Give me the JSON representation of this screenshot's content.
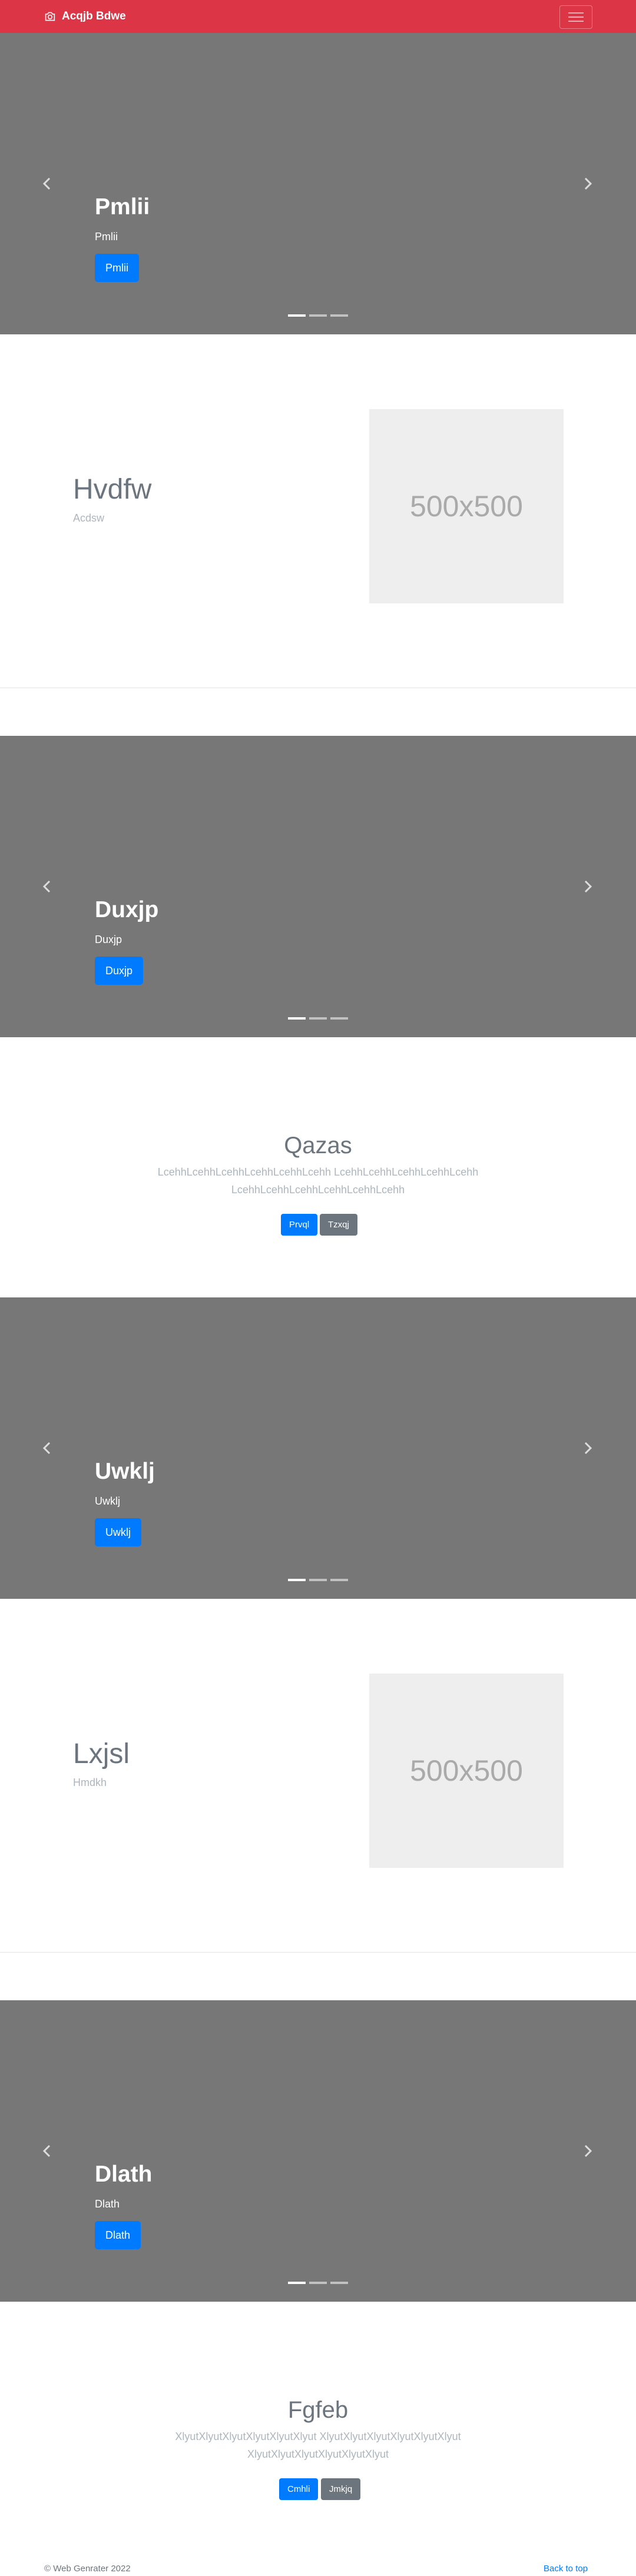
{
  "navbar": {
    "brand": "Acqjb Bdwe",
    "icon": "camera-icon",
    "toggler_icon": "hamburger-icon"
  },
  "carousels": [
    {
      "title": "Pmlii",
      "subtitle": "Pmlii",
      "button": "Pmlii"
    },
    {
      "title": "Duxjp",
      "subtitle": "Duxjp",
      "button": "Duxjp"
    },
    {
      "title": "Uwklj",
      "subtitle": "Uwklj",
      "button": "Uwklj"
    },
    {
      "title": "Dlath",
      "subtitle": "Dlath",
      "button": "Dlath"
    }
  ],
  "features": [
    {
      "title": "Hvdfw",
      "subtitle": "Acdsw",
      "image_label": "500x500"
    },
    {
      "title": "Lxjsl",
      "subtitle": "Hmdkh",
      "image_label": "500x500"
    }
  ],
  "jumbotrons": [
    {
      "title": "Qazas",
      "lead_line1": "LcehhLcehhLcehhLcehhLcehhLcehh LcehhLcehhLcehhLcehhLcehh",
      "lead_line2": "LcehhLcehhLcehhLcehhLcehhLcehh",
      "primary": "Prvql",
      "secondary": "Tzxqj"
    },
    {
      "title": "Fgfeb",
      "lead_line1": "XlyutXlyutXlyutXlyutXlyutXlyut XlyutXlyutXlyutXlyutXlyutXlyut",
      "lead_line2": "XlyutXlyutXlyutXlyutXlyutXlyut",
      "primary": "Cmhli",
      "secondary": "Jmkjq"
    }
  ],
  "footer": {
    "copyright": "© Web Genrater 2022",
    "back_to_top": "Back to top"
  },
  "colors": {
    "navbar": "#dc3545",
    "carousel_bg": "#777777",
    "primary": "#007bff",
    "secondary": "#6c757d"
  }
}
